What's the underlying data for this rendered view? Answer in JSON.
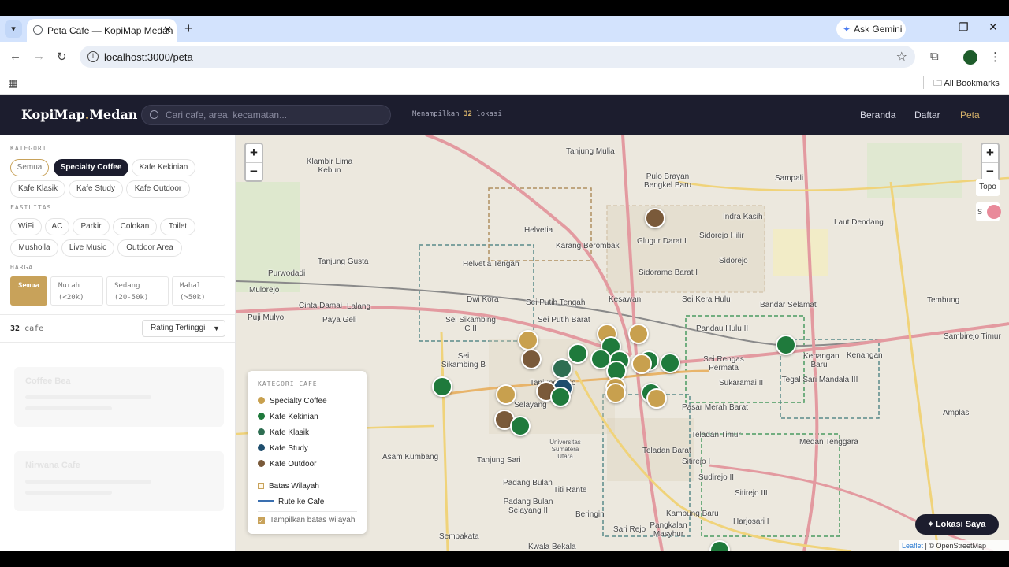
{
  "browser": {
    "tab_title": "Peta Cafe — KopiMap Medan",
    "url": "localhost:3000/peta",
    "gemini_label": "Ask Gemini",
    "bookmarks_label": "All Bookmarks"
  },
  "app": {
    "brand_name": "KopiMap",
    "brand_dot": ".",
    "brand_city": "Medan",
    "search_placeholder": "Cari cafe, area, kecamatan...",
    "showing_prefix": "Menampilkan",
    "showing_count": "32",
    "showing_suffix": "lokasi",
    "nav": [
      "Beranda",
      "Daftar",
      "Peta"
    ]
  },
  "sidebar": {
    "kategori_label": "KATEGORI",
    "kategori": [
      "Semua",
      "Specialty Coffee",
      "Kafe Kekinian",
      "Kafe Klasik",
      "Kafe Study",
      "Kafe Outdoor"
    ],
    "fasilitas_label": "FASILITAS",
    "fasilitas": [
      "WiFi",
      "AC",
      "Parkir",
      "Colokan",
      "Toilet",
      "Musholla",
      "Live Music",
      "Outdoor Area"
    ],
    "harga_label": "HARGA",
    "harga": [
      {
        "name": "Semua",
        "range": ""
      },
      {
        "name": "Murah",
        "range": "(<20k)"
      },
      {
        "name": "Sedang",
        "range": "(20-50k)"
      },
      {
        "name": "Mahal",
        "range": "(>50k)"
      }
    ],
    "count_num": "32",
    "count_unit": "cafe",
    "sort_value": "Rating Tertinggi",
    "ghost_cards": [
      "Coffee Bea",
      "Nirwana Cafe"
    ]
  },
  "map": {
    "zoom_in": "+",
    "zoom_out": "−",
    "topo_label": "Topo",
    "layer_label": "S",
    "labels": [
      "Tanjung Mulia",
      "Klambir Lima Kebun",
      "Pulo Brayan Bengkel Baru",
      "Sampali",
      "Indra Kasih",
      "Laut Dendang",
      "Helvetia",
      "Karang Berombak",
      "Glugur Darat I",
      "Sidorejo Hilir",
      "Tanjung Gusta",
      "Purwodadi",
      "Helvetia Tengah",
      "Sidorame Barat I",
      "Sidorejo",
      "Mulorejo",
      "Dwi Kora",
      "Sei Putih Tengah",
      "Kesawan",
      "Sei Kera Hulu",
      "Bandar Selamat",
      "Tembung",
      "Lalang",
      "Cinta Damai",
      "Pandau Hulu II",
      "Kenangan Baru",
      "Sambirejo Timur",
      "Puji Mulyo",
      "Paya Geli",
      "Sei Sikambing C II",
      "Sei Putih Barat",
      "Sei Rengas Permata",
      "Kenangan",
      "Sei Sikambing B",
      "Sukaramai II",
      "Tegal Sari Mandala III",
      "Tanjung Rejo",
      "Selayang",
      "Pasar Merah Barat",
      "Teladan Timur",
      "Medan Tenggara",
      "Amplas",
      "Asam Kumbang",
      "Tanjung Sari",
      "Universitas Sumatera Utara",
      "Teladan Barat",
      "Sitirejo I",
      "Sudirejo II",
      "Padang Bulan",
      "Titi Rante",
      "Sitirejo III",
      "Padang Bulan Selayang II",
      "Beringin",
      "Kampung Baru",
      "Harjosari I",
      "Sari Rejo",
      "Pangkalan Masyhur",
      "Sempakata",
      "Kwala Bekala"
    ],
    "marker_categories": [
      "Specialty Coffee",
      "Kafe Kekinian",
      "Kafe Klasik",
      "Kafe Study",
      "Kafe Outdoor"
    ],
    "colors": {
      "specialty": "#c8a04e",
      "kekinian": "#1f7a3c",
      "klasik": "#2e6e52",
      "study": "#1f4e6e",
      "outdoor": "#7a5a3a"
    },
    "legend": {
      "title": "KATEGORI CAFE",
      "items": [
        "Specialty Coffee",
        "Kafe Kekinian",
        "Kafe Klasik",
        "Kafe Study",
        "Kafe Outdoor"
      ],
      "boundary": "Batas Wilayah",
      "route": "Rute ke Cafe",
      "toggle": "Tampilkan batas wilayah"
    },
    "locate_label": "Lokasi Saya",
    "attribution_leaflet": "Leaflet",
    "attribution_rest": "| © OpenStreetMap"
  }
}
